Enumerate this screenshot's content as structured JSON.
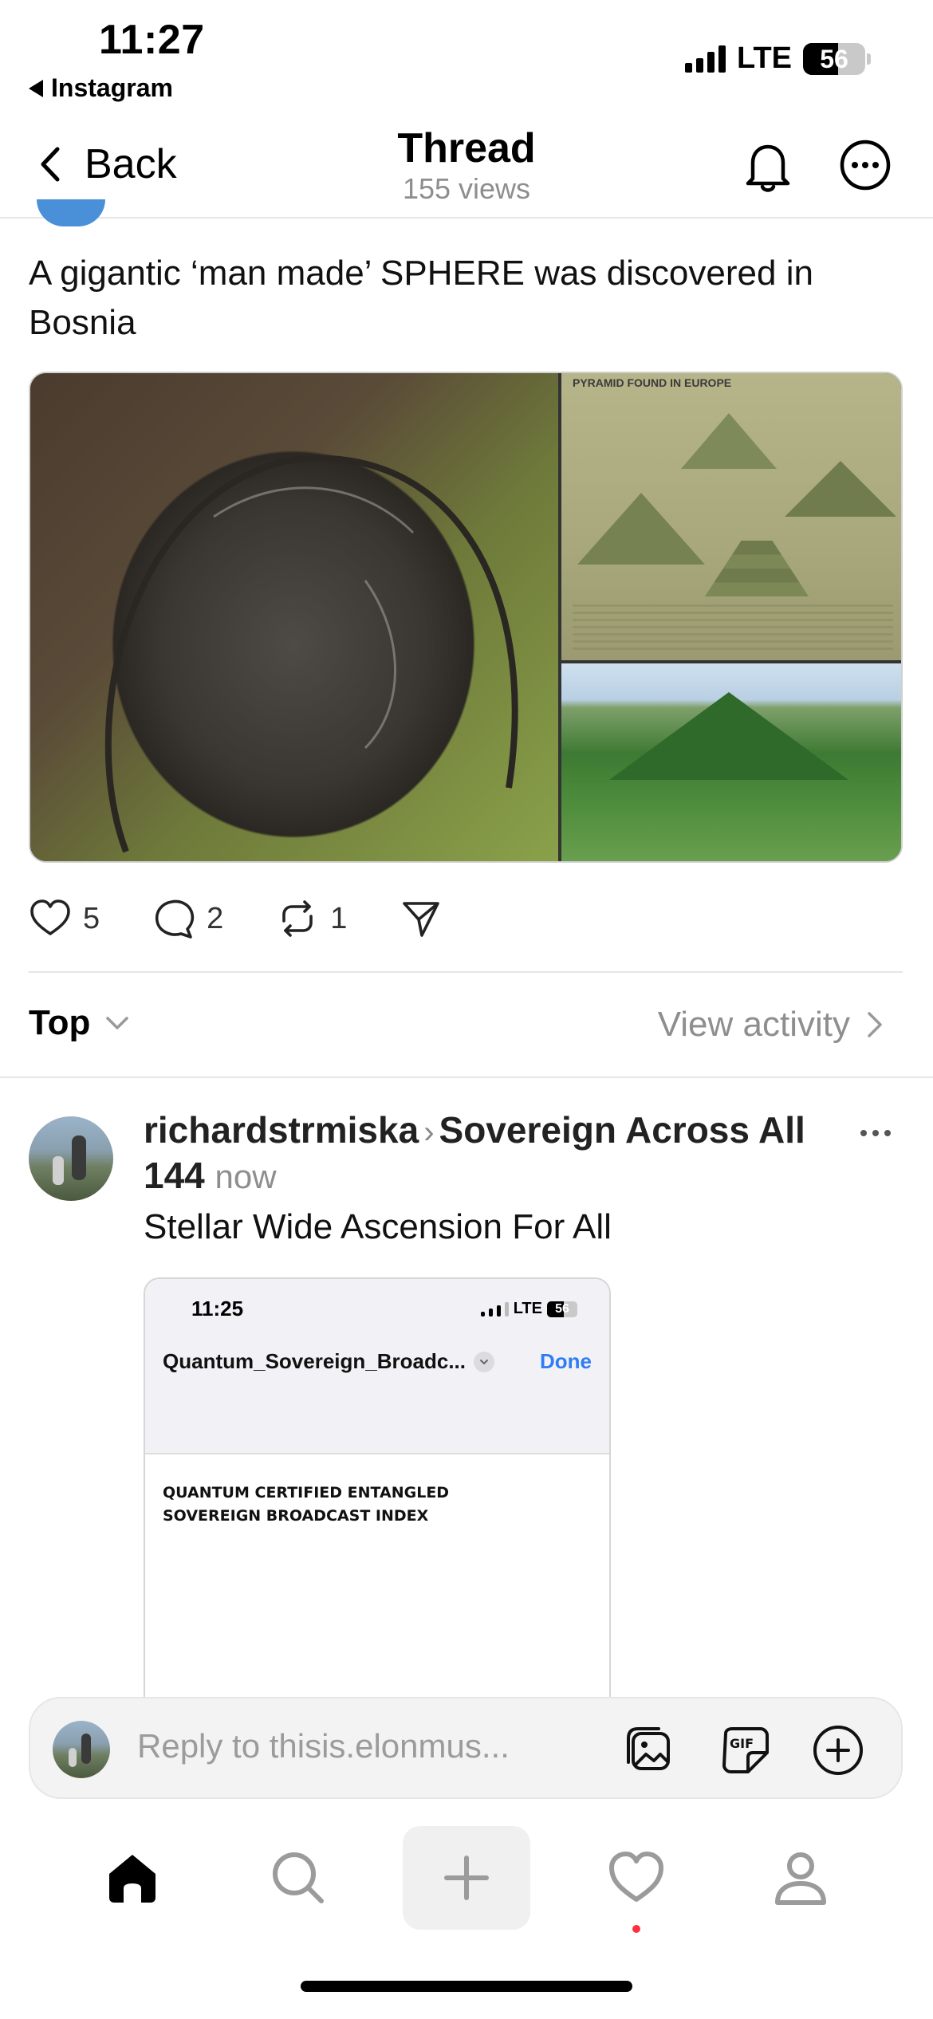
{
  "status_bar": {
    "time": "11:27",
    "back_app": "Instagram",
    "network": "LTE",
    "battery": "56"
  },
  "nav": {
    "back_label": "Back",
    "title": "Thread",
    "subtitle": "155 views"
  },
  "post": {
    "text": "A gigantic ‘man made’ SPHERE was discovered in Bosnia",
    "image_header": "PYRAMID FOUND IN EUROPE",
    "likes": "5",
    "comments": "2",
    "reposts": "1"
  },
  "sort": {
    "label": "Top",
    "view_activity": "View activity"
  },
  "reply": {
    "username": "richardstrmiska",
    "community": "Sovereign Across All 144",
    "time": "now",
    "text": "Stellar Wide Ascension For All",
    "embed": {
      "time": "11:25",
      "network": "LTE",
      "battery": "56",
      "file_name": "Quantum_Sovereign_Broadc...",
      "done_label": "Done",
      "doc_line1": "QUANTUM CERTIFIED ENTANGLED",
      "doc_line2": "SOVEREIGN BROADCAST INDEX"
    }
  },
  "composer": {
    "placeholder": "Reply to thisis.elonmus..."
  },
  "tabs": [
    "home",
    "search",
    "create",
    "activity",
    "profile"
  ],
  "colors": {
    "accent_blue": "#2f7cf6",
    "notification_dot": "#ff3040",
    "muted_text": "#8e8e8e"
  }
}
